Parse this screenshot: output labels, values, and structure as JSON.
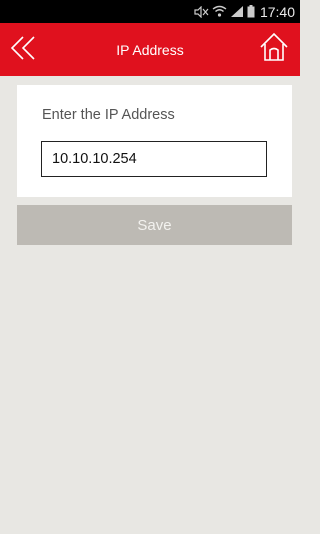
{
  "status_bar": {
    "time": "17:40",
    "icons": [
      "mute-icon",
      "wifi-icon",
      "signal-icon",
      "battery-icon"
    ]
  },
  "app_bar": {
    "title": "IP Address",
    "color": "#e0111e",
    "back_icon": "double-chevron-left-icon",
    "home_icon": "home-icon"
  },
  "form": {
    "label": "Enter the IP Address",
    "ip_value": "10.10.10.254"
  },
  "save_button": {
    "label": "Save",
    "color": "#bdbab4"
  }
}
